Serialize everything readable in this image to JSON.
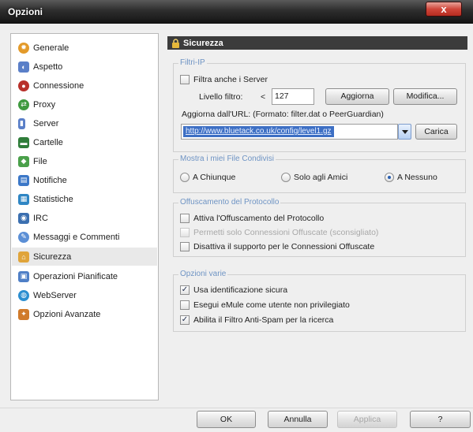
{
  "window": {
    "title": "Opzioni",
    "close_label": "x"
  },
  "sidebar": {
    "items": [
      {
        "label": "Generale",
        "icon": "gear-icon",
        "color": "#e39a2a",
        "selected": false
      },
      {
        "label": "Aspetto",
        "icon": "palette-icon",
        "color": "#5a7fc8",
        "selected": false
      },
      {
        "label": "Connessione",
        "icon": "bomb-icon",
        "color": "#b8302a",
        "selected": false
      },
      {
        "label": "Proxy",
        "icon": "proxy-icon",
        "color": "#3f9a3f",
        "selected": false
      },
      {
        "label": "Server",
        "icon": "server-icon",
        "color": "#5a7fc8",
        "selected": false
      },
      {
        "label": "Cartelle",
        "icon": "folder-icon",
        "color": "#2f7d3a",
        "selected": false
      },
      {
        "label": "File",
        "icon": "file-icon",
        "color": "#4aa04a",
        "selected": false
      },
      {
        "label": "Notifiche",
        "icon": "notification-icon",
        "color": "#3c78c8",
        "selected": false
      },
      {
        "label": "Statistiche",
        "icon": "statistics-icon",
        "color": "#2f86c4",
        "selected": false
      },
      {
        "label": "IRC",
        "icon": "irc-icon",
        "color": "#3b6fb0",
        "selected": false
      },
      {
        "label": "Messaggi e Commenti",
        "icon": "messages-icon",
        "color": "#5b8fd6",
        "selected": false
      },
      {
        "label": "Sicurezza",
        "icon": "lock-icon",
        "color": "#e0a43a",
        "selected": true
      },
      {
        "label": "Operazioni Pianificate",
        "icon": "calendar-icon",
        "color": "#4f7fc6",
        "selected": false
      },
      {
        "label": "WebServer",
        "icon": "globe-icon",
        "color": "#2b8ed0",
        "selected": false
      },
      {
        "label": "Opzioni Avanzate",
        "icon": "advanced-icon",
        "color": "#d07a2a",
        "selected": false
      }
    ]
  },
  "panel": {
    "title": "Sicurezza",
    "ipfilter": {
      "group_title": "Filtri-IP",
      "filter_servers_label": "Filtra anche i Server",
      "filter_servers_checked": false,
      "level_label": "Livello filtro:",
      "level_operator": "<",
      "level_value": "127",
      "update_button": "Aggiorna",
      "edit_button": "Modifica...",
      "url_label": "Aggiorna dall'URL: (Formato: filter.dat o PeerGuardian)",
      "url_value": "http://www.bluetack.co.uk/config/level1.gz",
      "load_button": "Carica"
    },
    "shared_files": {
      "group_title": "Mostra i miei File Condivisi",
      "options": [
        "A Chiunque",
        "Solo agli Amici",
        "A Nessuno"
      ],
      "selected_index": 2
    },
    "obfuscation": {
      "group_title": "Offuscamento del Protocollo",
      "items": [
        {
          "label": "Attiva l'Offuscamento del Protocollo",
          "checked": false,
          "disabled": false
        },
        {
          "label": "Permetti solo Connessioni Offuscate (sconsigliato)",
          "checked": false,
          "disabled": true
        },
        {
          "label": "Disattiva il supporto per le Connessioni Offuscate",
          "checked": false,
          "disabled": false
        }
      ]
    },
    "misc": {
      "group_title": "Opzioni varie",
      "items": [
        {
          "label": "Usa identificazione sicura",
          "checked": true
        },
        {
          "label": "Esegui eMule come utente non privilegiato",
          "checked": false
        },
        {
          "label": "Abilita il Filtro Anti-Spam per la ricerca",
          "checked": true
        }
      ]
    }
  },
  "footer": {
    "ok": "OK",
    "cancel": "Annulla",
    "apply": "Applica",
    "help": "?"
  }
}
